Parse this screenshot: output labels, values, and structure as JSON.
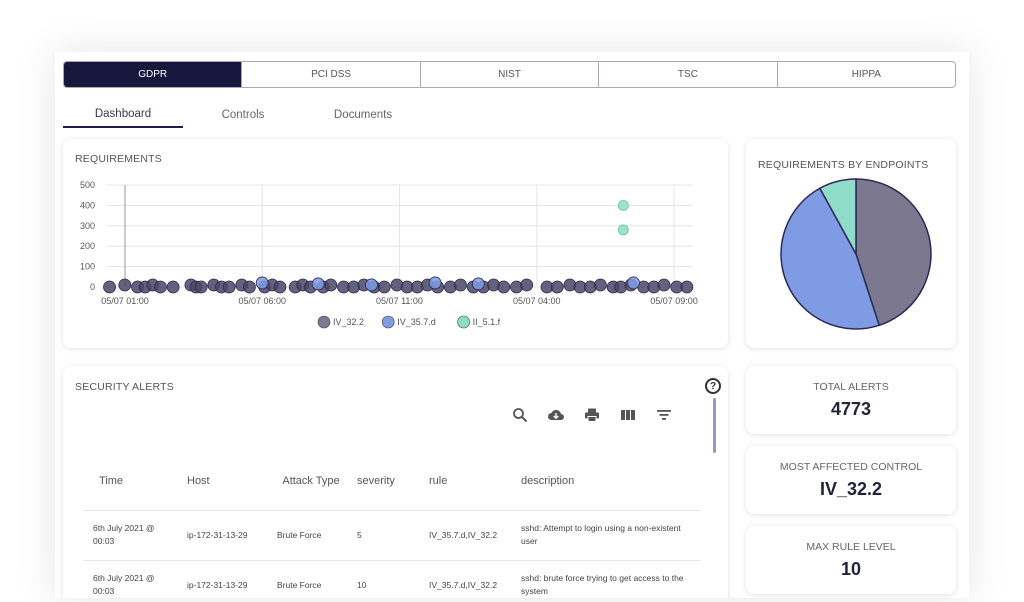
{
  "standards_tabs": [
    {
      "label": "GDPR",
      "active": true
    },
    {
      "label": "PCI DSS",
      "active": false
    },
    {
      "label": "NIST",
      "active": false
    },
    {
      "label": "TSC",
      "active": false
    },
    {
      "label": "HIPPA",
      "active": false
    }
  ],
  "sub_tabs": [
    {
      "label": "Dashboard",
      "active": true
    },
    {
      "label": "Controls",
      "active": false
    },
    {
      "label": "Documents",
      "active": false
    }
  ],
  "requirements_card": {
    "title": "REQUIREMENTS"
  },
  "endpoints_card": {
    "title": "REQUIREMENTS BY ENDPOINTS"
  },
  "alerts_card": {
    "title": "SECURITY ALERTS",
    "help_glyph": "?"
  },
  "toolbar": {
    "icons": [
      "search-icon",
      "cloud-download-icon",
      "print-icon",
      "columns-icon",
      "filter-icon"
    ]
  },
  "stats": [
    {
      "label": "TOTAL ALERTS",
      "value": "4773"
    },
    {
      "label": "MOST AFFECTED CONTROL",
      "value": "IV_32.2"
    },
    {
      "label": "MAX RULE LEVEL",
      "value": "10"
    }
  ],
  "table": {
    "columns": [
      "Time",
      "Host",
      "Attack Type",
      "severity",
      "rule",
      "description"
    ],
    "rows": [
      {
        "time": "6th July 2021 @ 00:03",
        "host": "ip-172-31-13-29",
        "attack_type": "Brute Force",
        "severity": "5",
        "rule": "IV_35.7.d,IV_32.2",
        "description": "sshd: Attempt to login using a non-existent user"
      },
      {
        "time": "6th July 2021 @ 00:03",
        "host": "ip-172-31-13-29",
        "attack_type": "Brute Force",
        "severity": "10",
        "rule": "IV_35.7.d,IV_32.2",
        "description": "sshd: brute force trying to get access to the system"
      }
    ]
  },
  "colors": {
    "navy": "#17163d",
    "series_iv32": "#7b7890",
    "series_iv357": "#7f9be3",
    "series_ii51": "#8fdcc8"
  },
  "chart_data": [
    {
      "type": "scatter",
      "title": "REQUIREMENTS",
      "x_tick_labels": [
        "05/07 01:00",
        "05/07 06:00",
        "05/07 11:00",
        "05/07 04:00",
        "05/07 09:00"
      ],
      "y_tick_labels": [
        "500",
        "400",
        "300",
        "200",
        "100",
        "0"
      ],
      "ylim": [
        0,
        500
      ],
      "grid": true,
      "legend_position": "bottom",
      "series": [
        {
          "name": "IV_32.2",
          "color": "#4a4766",
          "x": [
            0.1,
            0.7,
            1.2,
            1.5,
            1.8,
            2.1,
            2.6,
            3.3,
            3.5,
            3.7,
            4.2,
            4.5,
            4.8,
            5.3,
            5.6,
            6.2,
            6.5,
            6.8,
            7.4,
            7.7,
            8.0,
            8.5,
            8.8,
            9.3,
            9.7,
            10.1,
            10.5,
            10.9,
            11.4,
            11.8,
            12.2,
            12.6,
            13.0,
            13.5,
            13.9,
            14.4,
            14.8,
            15.2,
            15.6,
            16.1,
            16.5,
            17.3,
            17.7,
            18.2,
            18.6,
            19.0,
            19.4,
            19.9,
            20.2,
            20.6,
            21.1,
            21.5,
            21.9,
            22.4,
            22.8
          ],
          "y": [
            0,
            0,
            0,
            0,
            0,
            0,
            0,
            0,
            0,
            0,
            0,
            0,
            0,
            0,
            0,
            0,
            0,
            0,
            0,
            0,
            0,
            0,
            0,
            0,
            0,
            0,
            0,
            0,
            0,
            0,
            0,
            0,
            0,
            0,
            0,
            0,
            0,
            0,
            0,
            0,
            0,
            0,
            0,
            0,
            0,
            0,
            0,
            0,
            0,
            0,
            0,
            0,
            0,
            0,
            0
          ]
        },
        {
          "name": "IV_35.7.d",
          "color": "#7f9be3",
          "x": [
            6.1,
            8.3,
            10.4,
            12.9,
            14.6,
            20.7
          ],
          "y": [
            20,
            15,
            10,
            20,
            15,
            20
          ]
        },
        {
          "name": "II_5.1.f",
          "color": "#8fdcc8",
          "x": [
            20.3,
            20.3
          ],
          "y": [
            400,
            280
          ]
        }
      ]
    },
    {
      "type": "pie",
      "title": "REQUIREMENTS BY ENDPOINTS",
      "slices": [
        {
          "name": "IV_32.2",
          "value": 45,
          "color": "#7b7890"
        },
        {
          "name": "IV_35.7.d",
          "value": 47,
          "color": "#7f9be3"
        },
        {
          "name": "II_5.1.f",
          "value": 8,
          "color": "#8fdcc8"
        }
      ]
    }
  ]
}
